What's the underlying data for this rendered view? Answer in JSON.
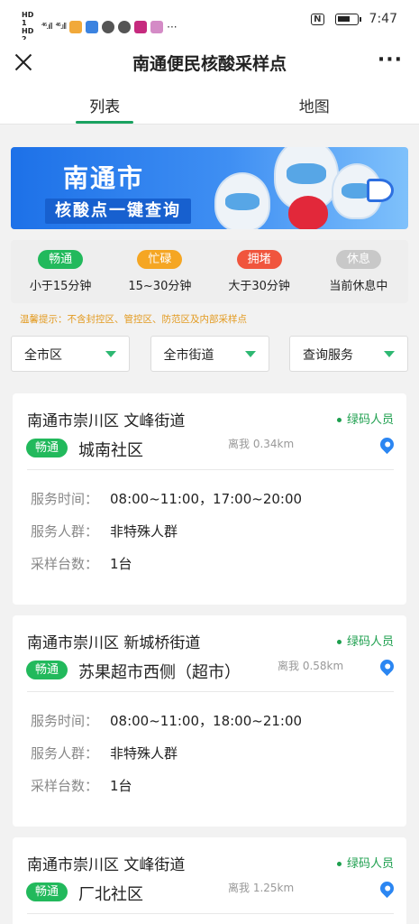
{
  "status_bar": {
    "sim1": "HD 1",
    "sim2": "HD 2",
    "signal1": "⁴⁶.ıll",
    "signal2": "⁴⁶.ıll",
    "dots": "···",
    "nfc": "N",
    "time": "7:47",
    "battery_level": 0.7
  },
  "header": {
    "title": "南通便民核酸采样点"
  },
  "tabs": [
    {
      "label": "列表",
      "active": true
    },
    {
      "label": "地图",
      "active": false
    }
  ],
  "banner": {
    "city": "南通市",
    "subtitle": "核酸点一键查询"
  },
  "legend": [
    {
      "badge": "畅通",
      "desc": "小于15分钟",
      "color": "#22b95c"
    },
    {
      "badge": "忙碌",
      "desc": "15~30分钟",
      "color": "#f5a623"
    },
    {
      "badge": "拥堵",
      "desc": "大于30分钟",
      "color": "#f0553d"
    },
    {
      "badge": "休息",
      "desc": "当前休息中",
      "color": "#c8c8c8"
    }
  ],
  "notice": "温馨提示：不含封控区、管控区、防范区及内部采样点",
  "filters": [
    {
      "label": "全市区"
    },
    {
      "label": "全市街道"
    },
    {
      "label": "查询服务"
    }
  ],
  "row_labels": {
    "time": "服务时间：",
    "group": "服务人群：",
    "count": "采样台数："
  },
  "cards": [
    {
      "street": "南通市崇川区 文峰街道",
      "tag": "绿码人员",
      "status": "畅通",
      "name": "城南社区",
      "distance": "离我 0.34km",
      "time": "08:00~11:00，17:00~20:00",
      "group": "非特殊人群",
      "count": "1台"
    },
    {
      "street": "南通市崇川区 新城桥街道",
      "tag": "绿码人员",
      "status": "畅通",
      "name": "苏果超市西侧（超市）",
      "distance": "离我 0.58km",
      "time": "08:00~11:00，18:00~21:00",
      "group": "非特殊人群",
      "count": "1台"
    },
    {
      "street": "南通市崇川区 文峰街道",
      "tag": "绿码人员",
      "status": "畅通",
      "name": "厂北社区",
      "distance": "离我 1.25km"
    }
  ]
}
